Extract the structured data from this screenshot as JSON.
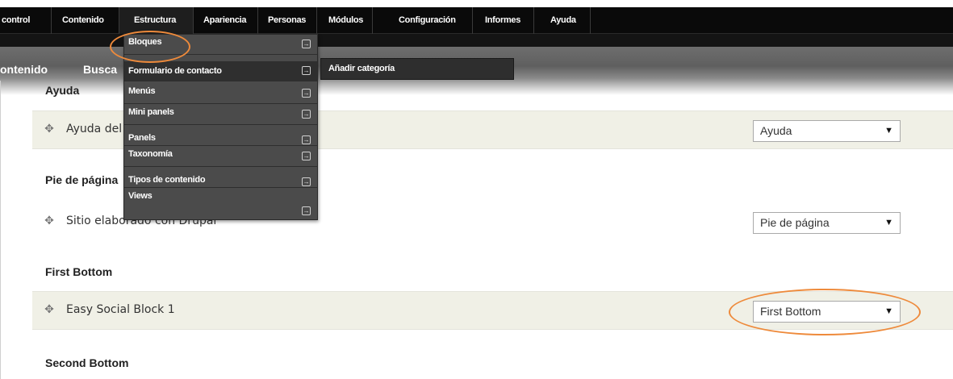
{
  "admin_menu": {
    "items": [
      "control",
      "Contenido",
      "Estructura",
      "Apariencia",
      "Personas",
      "Módulos",
      "Configuración",
      "Informes",
      "Ayuda"
    ]
  },
  "shortcuts": {
    "items": [
      "ontenido",
      "Busca"
    ]
  },
  "structure_dropdown": {
    "items": [
      "Bloques",
      "Formulario de contacto",
      "Menús",
      "Mini panels",
      "Panels",
      "Taxonomía",
      "Tipos de contenido",
      "Views"
    ],
    "arrow_glyph": "→"
  },
  "submenu": {
    "item": "Añadir categoría"
  },
  "regions": {
    "ayuda": {
      "heading": "Ayuda",
      "block": "Ayuda del sistema",
      "region_value": "Ayuda"
    },
    "pie": {
      "heading": "Pie de página",
      "block": "Sitio elaborado con Drupal",
      "region_value": "Pie de página"
    },
    "first_bottom": {
      "heading": "First Bottom",
      "block": "Easy Social Block 1",
      "region_value": "First Bottom"
    },
    "second_bottom": {
      "heading": "Second Bottom"
    }
  },
  "icons": {
    "drag": "move-handle-icon",
    "select_arrow": "▼"
  },
  "colors": {
    "highlight_oval": "#ee8a3b",
    "admin_bar": "#0a0a0a",
    "dropdown_bg": "#4b4b4b",
    "row_bg": "#f0f0e6"
  }
}
